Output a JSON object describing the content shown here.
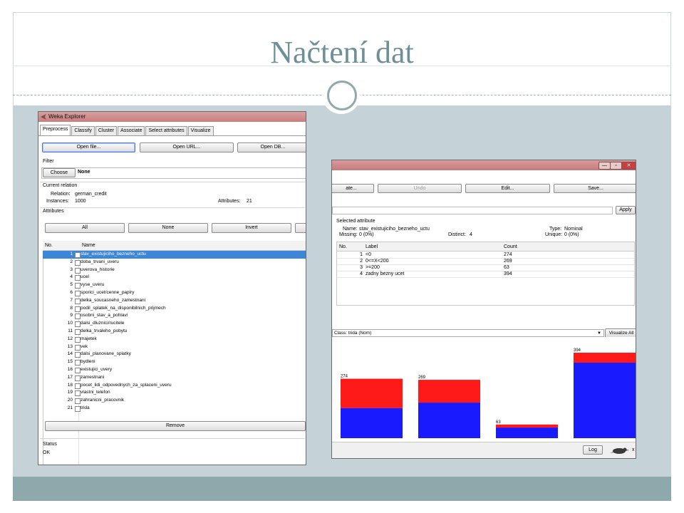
{
  "slide": {
    "title": "Načtení dat"
  },
  "left_window": {
    "title": "Weka Explorer",
    "tabs": [
      "Preprocess",
      "Classify",
      "Cluster",
      "Associate",
      "Select attributes",
      "Visualize"
    ],
    "buttons": {
      "open_file": "Open file...",
      "open_url": "Open URL...",
      "open_db": "Open DB...",
      "choose": "Choose",
      "all": "All",
      "none": "None",
      "invert": "Invert",
      "remove": "Remove"
    },
    "filter": {
      "section_label": "Filter",
      "value": "None"
    },
    "current_relation": {
      "section_label": "Current relation",
      "relation_label": "Relation:",
      "relation_value": "german_credit",
      "instances_label": "Instances:",
      "instances_value": "1000",
      "attributes_label": "Attributes:",
      "attributes_value": "21"
    },
    "attributes_section_label": "Attributes",
    "table_headers": {
      "no": "No.",
      "name": "Name"
    },
    "attributes": [
      {
        "no": "1",
        "name": "stav_existujiciho_bezneho_uctu"
      },
      {
        "no": "2",
        "name": "doba_trvani_uveru"
      },
      {
        "no": "3",
        "name": "uverova_historie"
      },
      {
        "no": "4",
        "name": "ucel"
      },
      {
        "no": "5",
        "name": "vyse_uveru"
      },
      {
        "no": "6",
        "name": "sporici_ucet/cenne_papiry"
      },
      {
        "no": "7",
        "name": "delka_soucasneho_zamestnani"
      },
      {
        "no": "8",
        "name": "podil_splatek_na_disponibilnich_prijmech"
      },
      {
        "no": "9",
        "name": "osobni_stav_a_pohlavi"
      },
      {
        "no": "10",
        "name": "dalsi_dluznici/rucitele"
      },
      {
        "no": "11",
        "name": "delka_trvaleho_pobytu"
      },
      {
        "no": "12",
        "name": "majetek"
      },
      {
        "no": "13",
        "name": "vek"
      },
      {
        "no": "14",
        "name": "dalsi_planovane_splatky"
      },
      {
        "no": "15",
        "name": "bydleni"
      },
      {
        "no": "16",
        "name": "existujici_uvery"
      },
      {
        "no": "17",
        "name": "zamestnani"
      },
      {
        "no": "18",
        "name": "pocet_lidi_odpovednych_za_splaceni_uveru"
      },
      {
        "no": "19",
        "name": "vlastni_telefon"
      },
      {
        "no": "20",
        "name": "zahranicni_pracovnik"
      },
      {
        "no": "21",
        "name": "trida"
      }
    ],
    "selected_attribute_index": 0,
    "status": {
      "label": "Status",
      "value": "OK"
    }
  },
  "right_window": {
    "buttons": {
      "generate": "ate...",
      "undo": "Undo",
      "edit": "Edit...",
      "save": "Save...",
      "apply": "Apply",
      "visualize_all": "Visualize All",
      "log": "Log"
    },
    "window_controls": {
      "minimize": "—",
      "maximize": "▫",
      "close": "✕"
    },
    "selected_attribute": {
      "section_label": "Selected attribute",
      "name_label": "Name:",
      "name_value": "stav_existujiciho_bezneho_uctu",
      "missing_label": "Missing:",
      "missing_value": "0 (0%)",
      "distinct_label": "Distinct:",
      "distinct_value": "4",
      "type_label": "Type:",
      "type_value": "Nominal",
      "unique_label": "Unique:",
      "unique_value": "0 (0%)"
    },
    "table_headers": {
      "no": "No.",
      "label": "Label",
      "count": "Count"
    },
    "rows": [
      {
        "no": "1",
        "label": "<0",
        "count": "274"
      },
      {
        "no": "2",
        "label": "0<=X<200",
        "count": "269"
      },
      {
        "no": "3",
        "label": ">=200",
        "count": "63"
      },
      {
        "no": "4",
        "label": "zadny bezny ucet",
        "count": "394"
      }
    ],
    "class_selector": "Class: trida (Nom)",
    "bottom_close": "x"
  },
  "chart_data": {
    "type": "bar",
    "stacked": true,
    "categories": [
      "<0",
      "0<=X<200",
      ">=200",
      "zadny bezny ucet"
    ],
    "totals": [
      274,
      269,
      63,
      394
    ],
    "series": [
      {
        "color": "#1a1aff",
        "values": [
          139,
          164,
          49,
          348
        ]
      },
      {
        "color": "#ff1a1a",
        "values": [
          135,
          105,
          14,
          46
        ]
      }
    ],
    "ylim": [
      0,
      394
    ]
  }
}
